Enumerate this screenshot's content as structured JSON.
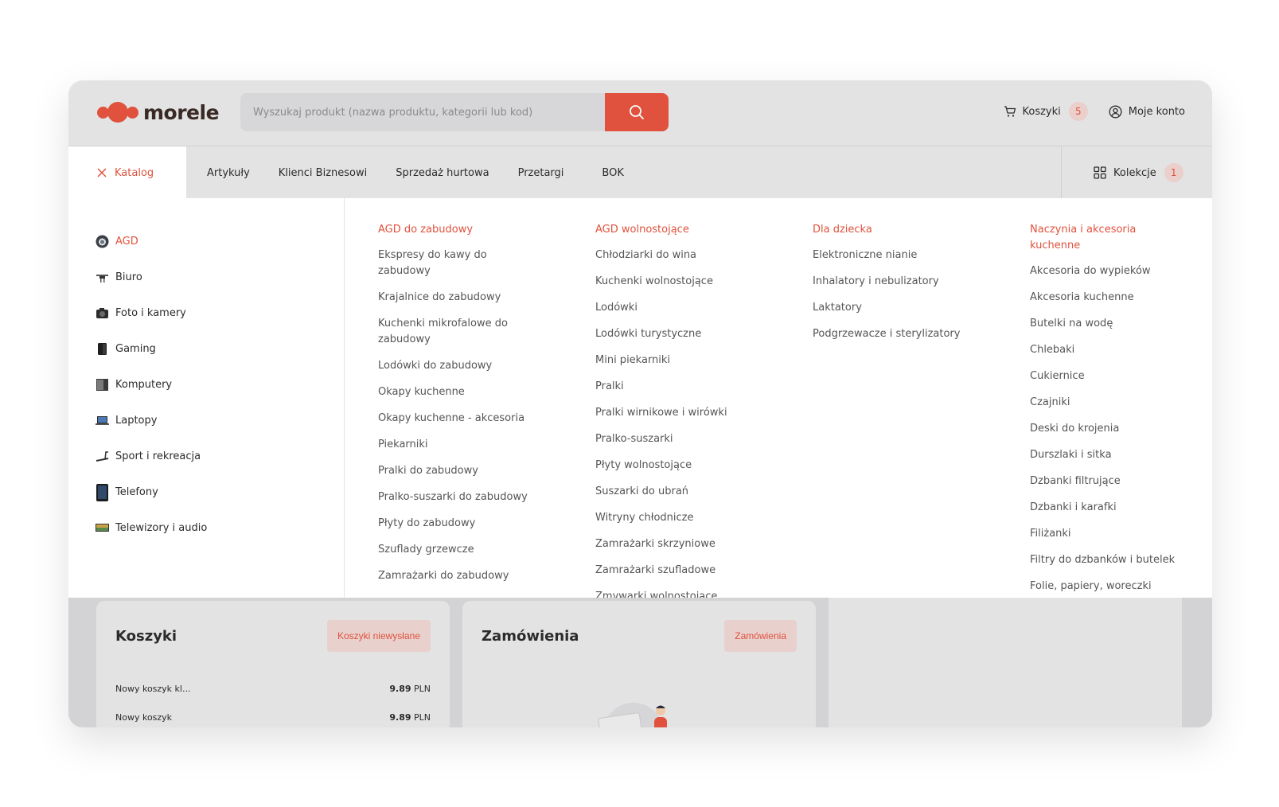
{
  "brand": {
    "name": "morele",
    "color": "#e0523d"
  },
  "search": {
    "placeholder": "Wyszukaj produkt (nazwa produktu, kategorii lub kod)",
    "icon": "search-icon"
  },
  "header": {
    "cart": {
      "label": "Koszyki",
      "count": "5",
      "icon": "cart-icon"
    },
    "account": {
      "label": "Moje konto",
      "icon": "user-circle-icon"
    }
  },
  "nav": {
    "catalog_label": "Katalog",
    "links": [
      "Artykuły",
      "Klienci Biznesowi",
      "Sprzedaż hurtowa",
      "Przetargi",
      "BOK"
    ],
    "collections": {
      "label": "Kolekcje",
      "count": "1",
      "icon": "grid-icon"
    }
  },
  "categories": [
    {
      "label": "AGD",
      "icon": "washing-machine-icon",
      "active": true
    },
    {
      "label": "Biuro",
      "icon": "drone-icon"
    },
    {
      "label": "Foto i kamery",
      "icon": "camera-icon"
    },
    {
      "label": "Gaming",
      "icon": "gamepad-icon"
    },
    {
      "label": "Komputery",
      "icon": "pc-case-icon"
    },
    {
      "label": "Laptopy",
      "icon": "laptop-icon"
    },
    {
      "label": "Sport i rekreacja",
      "icon": "treadmill-icon"
    },
    {
      "label": "Telefony",
      "icon": "phone-icon"
    },
    {
      "label": "Telewizory i audio",
      "icon": "tv-icon"
    }
  ],
  "subcategories": [
    {
      "heading": "AGD do zabudowy",
      "items": [
        "Ekspresy do kawy do zabudowy",
        "Krajalnice do zabudowy",
        "Kuchenki mikrofalowe do zabudowy",
        "Lodówki do zabudowy",
        "Okapy kuchenne",
        "Okapy kuchenne - akcesoria",
        "Piekarniki",
        "Pralki do zabudowy",
        "Pralko-suszarki do zabudowy",
        "Płyty do zabudowy",
        "Szuflady grzewcze",
        "Zamrażarki do zabudowy"
      ]
    },
    {
      "heading": "AGD wolnostojące",
      "items": [
        "Chłodziarki do wina",
        "Kuchenki wolnostojące",
        "Lodówki",
        "Lodówki turystyczne",
        "Mini piekarniki",
        "Pralki",
        "Pralki wirnikowe i wirówki",
        "Pralko-suszarki",
        "Płyty wolnostojące",
        "Suszarki do ubrań",
        "Witryny chłodnicze",
        "Zamrażarki skrzyniowe",
        "Zamrażarki szufladowe",
        "Zmywarki wolnostojące"
      ]
    },
    {
      "heading": "Dla dziecka",
      "items": [
        "Elektroniczne nianie",
        "Inhalatory i nebulizatory",
        "Laktatory",
        "Podgrzewacze i sterylizatory"
      ]
    },
    {
      "heading": "Naczynia i akcesoria kuchenne",
      "items": [
        "Akcesoria do wypieków",
        "Akcesoria kuchenne",
        "Butelki na wodę",
        "Chlebaki",
        "Cukiernice",
        "Czajniki",
        "Deski do krojenia",
        "Durszlaki i sitka",
        "Dzbanki filtrujące",
        "Dzbanki i karafki",
        "Filiżanki",
        "Filtry do dzbanków i butelek",
        "Folie, papiery, woreczki"
      ]
    }
  ],
  "cards": {
    "carts": {
      "title": "Koszyki",
      "button": "Koszyki niewysłane",
      "rows": [
        {
          "name": "Nowy koszyk kl...",
          "amount": "9.89",
          "currency": "PLN"
        },
        {
          "name": "Nowy koszyk",
          "amount": "9.89",
          "currency": "PLN"
        }
      ]
    },
    "orders": {
      "title": "Zamówienia",
      "button": "Zamówienia",
      "illustration": "empty-orders-illustration"
    }
  }
}
